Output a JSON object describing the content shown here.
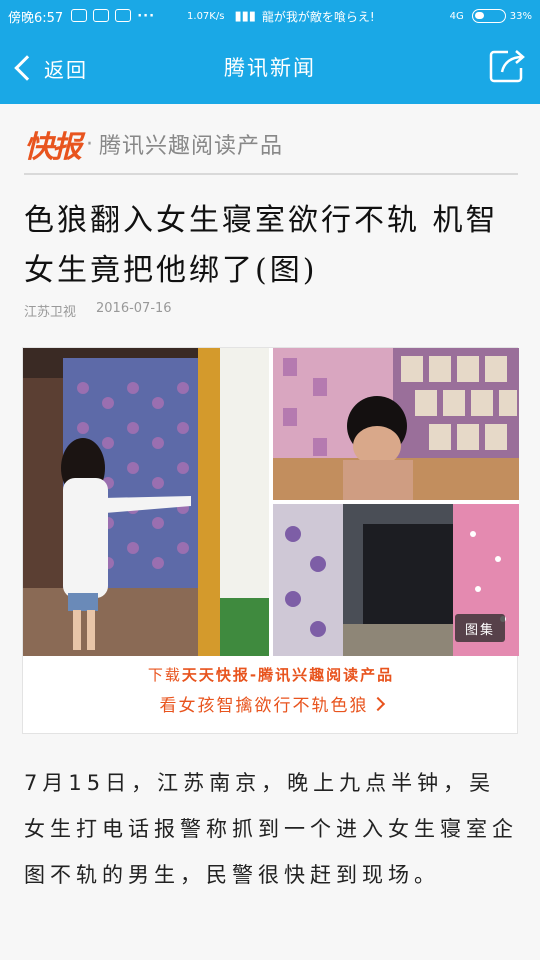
{
  "status_bar": {
    "time": "傍晚6:57",
    "speed": "1.07K/s",
    "carrier": "龍が我が敵を喰らえ!",
    "network": "4G",
    "battery_pct": "33%",
    "battery_level": 0.33
  },
  "nav": {
    "back_label": "返回",
    "title": "腾讯新闻"
  },
  "brand": {
    "logo": "快报",
    "separator": "·",
    "tagline": "腾讯兴趣阅读产品"
  },
  "article": {
    "headline": "色狼翻入女生寝室欲行不轨 机智女生竟把他绑了(图)",
    "source": "江苏卫视",
    "date": "2016-07-16",
    "gallery_label": "图集",
    "body": "7月15日，江苏南京，晚上九点半钟，吴女生打电话报警称抓到一个进入女生寝室企图不轨的男生，民警很快赶到现场。"
  },
  "promo": {
    "prefix": "下载",
    "app_name": "天天快报-腾讯兴趣阅读产品",
    "link_text": "看女孩智擒欲行不轨色狼"
  },
  "colors": {
    "header": "#1aa8e6",
    "accent": "#e8541e"
  }
}
